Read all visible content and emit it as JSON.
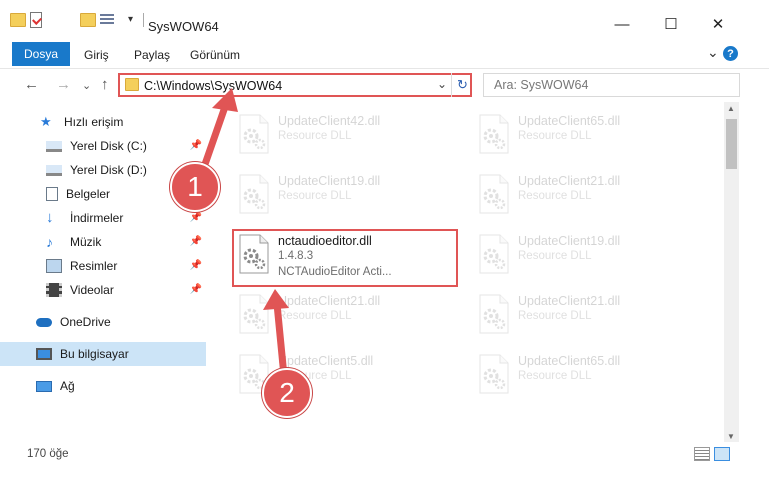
{
  "window": {
    "title": "SysWOW64",
    "minimize_glyph": "—",
    "maximize_glyph": "☐",
    "close_glyph": "✕"
  },
  "ribbon": {
    "tabs": [
      "Dosya",
      "Giriş",
      "Paylaş",
      "Görünüm"
    ],
    "expand_glyph": "⌄",
    "help_glyph": "?"
  },
  "nav": {
    "back_glyph": "←",
    "forward_glyph": "→",
    "recent_glyph": "⌄",
    "up_glyph": "↑",
    "address": "C:\\Windows\\SysWOW64",
    "dropdown_glyph": "⌄",
    "refresh_glyph": "↻",
    "search_placeholder": "Ara: SysWOW64"
  },
  "sidebar": {
    "items": [
      {
        "label": "Hızlı erişim",
        "icon": "star-icon"
      },
      {
        "label": "Yerel Disk (C:)",
        "icon": "drive-icon"
      },
      {
        "label": "Yerel Disk (D:)",
        "icon": "drive-icon"
      },
      {
        "label": "Belgeler",
        "icon": "documents-icon"
      },
      {
        "label": "İndirmeler",
        "icon": "download-icon"
      },
      {
        "label": "Müzik",
        "icon": "music-icon"
      },
      {
        "label": "Resimler",
        "icon": "pictures-icon"
      },
      {
        "label": "Videolar",
        "icon": "videos-icon"
      },
      {
        "label": "OneDrive",
        "icon": "cloud-icon"
      },
      {
        "label": "Bu bilgisayar",
        "icon": "computer-icon"
      },
      {
        "label": "Ağ",
        "icon": "network-icon"
      }
    ],
    "pin_glyph": "📌"
  },
  "files": {
    "left": [
      {
        "name": "UpdateClient42.dll",
        "desc": "Resource DLL"
      },
      {
        "name": "UpdateClient19.dll",
        "desc": "Resource DLL"
      },
      {
        "name": "UpdateClient21.dll",
        "desc": "Resource DLL"
      },
      {
        "name": "UpdateClient5.dll",
        "desc": "Resource DLL"
      }
    ],
    "right": [
      {
        "name": "UpdateClient65.dll",
        "desc": "Resource DLL"
      },
      {
        "name": "UpdateClient21.dll",
        "desc": "Resource DLL"
      },
      {
        "name": "UpdateClient19.dll",
        "desc": "Resource DLL"
      },
      {
        "name": "UpdateClient21.dll",
        "desc": "Resource DLL"
      },
      {
        "name": "UpdateClient65.dll",
        "desc": "Resource DLL"
      }
    ],
    "focused": {
      "name": "nctaudioeditor.dll",
      "version": "1.4.8.3",
      "desc": "NCTAudioEditor Acti..."
    }
  },
  "status": {
    "count": "170 öğe"
  },
  "callouts": {
    "one": "1",
    "two": "2"
  },
  "colors": {
    "accent": "#1979ca",
    "highlight": "#e05555",
    "selected": "#cce4f7"
  }
}
